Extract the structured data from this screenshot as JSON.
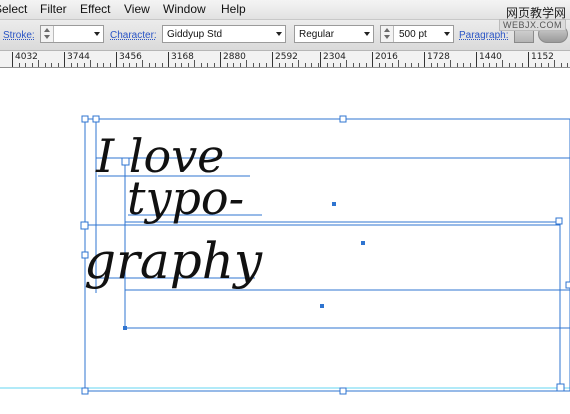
{
  "menu": [
    "Select",
    "Filter",
    "Effect",
    "View",
    "Window",
    "Help"
  ],
  "watermark": {
    "cn": "网页教学网",
    "url": "WEBJX.COM"
  },
  "control_bar": {
    "stroke_label": "Stroke:",
    "character_label": "Character:",
    "font_family": "Giddyup Std",
    "font_style": "Regular",
    "font_size": "500 pt",
    "paragraph_label": "Paragraph:"
  },
  "ruler": {
    "labels": [
      "4032",
      "3744",
      "3456",
      "3168",
      "2880",
      "2592",
      "2304",
      "2016",
      "1728",
      "1440",
      "1152"
    ]
  },
  "artwork": {
    "lines": [
      "I love",
      "typo-",
      "graphy"
    ]
  },
  "colors": {
    "selection": "#2f74d0",
    "link": "#2a55c6",
    "canvas_guide": "#63d6f0"
  }
}
